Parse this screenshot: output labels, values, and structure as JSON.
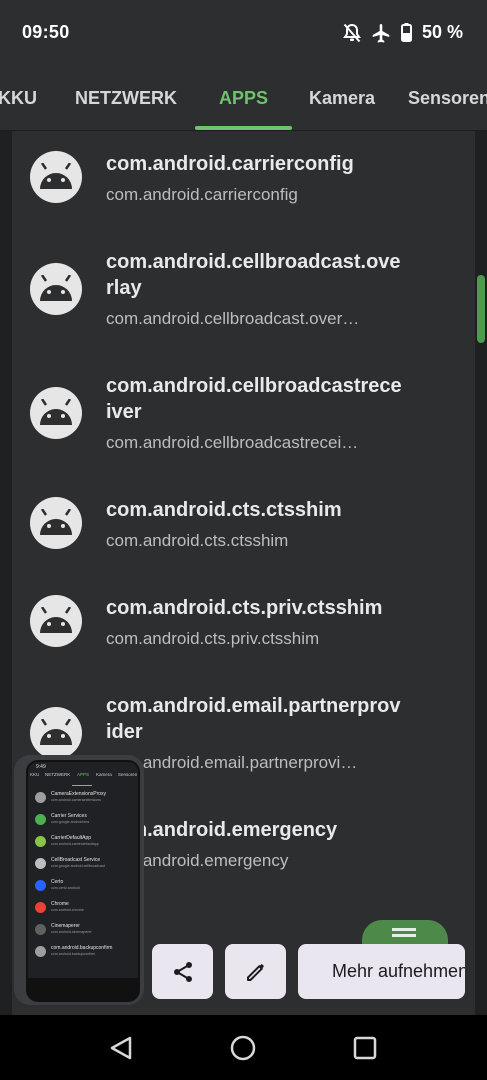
{
  "status": {
    "time": "09:50",
    "battery": "50 %"
  },
  "tabs": [
    {
      "label": "KKU"
    },
    {
      "label": "NETZWERK"
    },
    {
      "label": "APPS",
      "active": true
    },
    {
      "label": "Kamera"
    },
    {
      "label": "Sensoren"
    }
  ],
  "apps": [
    {
      "title": "com.android.carrierconfig",
      "package": "com.android.carrierconfig"
    },
    {
      "title": "com.android.cellbroadcast.overlay",
      "package": "com.android.cellbroadcast.over…"
    },
    {
      "title": "com.android.cellbroadcastreceiver",
      "package": "com.android.cellbroadcastrecei…"
    },
    {
      "title": "com.android.cts.ctsshim",
      "package": "com.android.cts.ctsshim"
    },
    {
      "title": "com.android.cts.priv.ctsshim",
      "package": "com.android.cts.priv.ctsshim"
    },
    {
      "title": "com.android.email.partnerprovider",
      "package": "com.android.email.partnerprovi…"
    },
    {
      "title": "com.android.emergency",
      "package": "com.android.emergency"
    }
  ],
  "screenshot_toolbar": {
    "capture_more_label": "Mehr aufnehmen"
  },
  "thumbnail": {
    "time": "9:49",
    "tabs": [
      "KKU",
      "NETZWERK",
      "APPS",
      "Kamera",
      "Sensoren"
    ],
    "rows": [
      {
        "name": "CameraExtensionsProxy",
        "pkg": "com.android.cameraextensions",
        "color": "#9e9e9e"
      },
      {
        "name": "Carrier Services",
        "pkg": "com.google.android.ims",
        "color": "#4caf50"
      },
      {
        "name": "CarrierDefaultApp",
        "pkg": "com.android.carrierdefaultapp",
        "color": "#8bc34a"
      },
      {
        "name": "CellBroadcast Service",
        "pkg": "com.google.android.cellbroadcast",
        "color": "#bdbdbd"
      },
      {
        "name": "Certo",
        "pkg": "com.certo.android",
        "color": "#2962ff"
      },
      {
        "name": "Chrome",
        "pkg": "com.android.chrome",
        "color": "#ea4335"
      },
      {
        "name": "Cinemaperer",
        "pkg": "com.android.cinemaperer",
        "color": "#616161"
      },
      {
        "name": "com.android.backupconfirm",
        "pkg": "com.android.backupconfirm",
        "color": "#9e9e9e"
      }
    ]
  }
}
